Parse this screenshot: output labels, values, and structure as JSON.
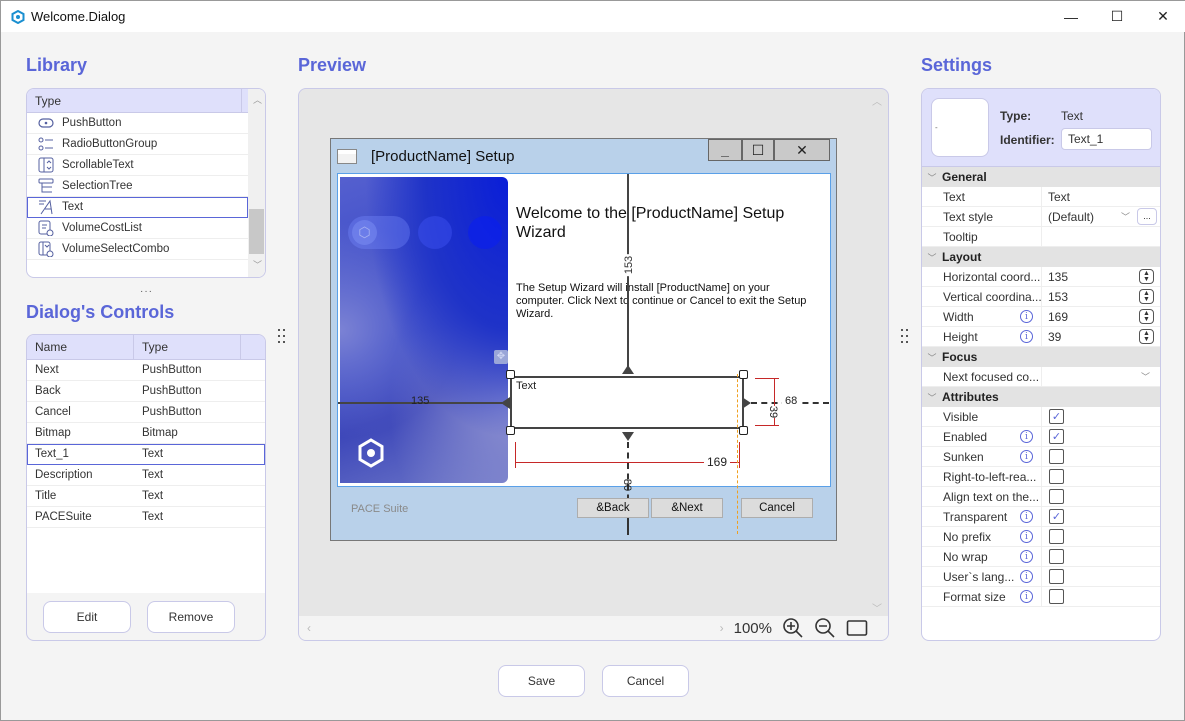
{
  "window": {
    "title": "Welcome.Dialog",
    "minimize_glyph": "—",
    "maximize_glyph": "☐",
    "close_glyph": "✕"
  },
  "library": {
    "title": "Library",
    "column": "Type",
    "items": [
      {
        "label": "PushButton",
        "icon": "push-button-icon"
      },
      {
        "label": "RadioButtonGroup",
        "icon": "radio-group-icon"
      },
      {
        "label": "ScrollableText",
        "icon": "scrollable-text-icon"
      },
      {
        "label": "SelectionTree",
        "icon": "selection-tree-icon"
      },
      {
        "label": "Text",
        "icon": "text-icon",
        "selected": true
      },
      {
        "label": "VolumeCostList",
        "icon": "volume-cost-list-icon"
      },
      {
        "label": "VolumeSelectCombo",
        "icon": "volume-select-combo-icon"
      }
    ]
  },
  "controls": {
    "title": "Dialog's Controls",
    "columns": [
      "Name",
      "Type"
    ],
    "rows": [
      [
        "Next",
        "PushButton"
      ],
      [
        "Back",
        "PushButton"
      ],
      [
        "Cancel",
        "PushButton"
      ],
      [
        "Bitmap",
        "Bitmap"
      ],
      [
        "Text_1",
        "Text"
      ],
      [
        "Description",
        "Text"
      ],
      [
        "Title",
        "Text"
      ],
      [
        "PACESuite",
        "Text"
      ]
    ],
    "selected_index": 4,
    "edit_label": "Edit",
    "remove_label": "Remove"
  },
  "preview": {
    "title": "Preview",
    "dialog_title": "[ProductName] Setup",
    "heading": "Welcome to the [ProductName] Setup Wizard",
    "description": "The Setup Wizard will install [ProductName] on your computer. Click Next to continue or Cancel to exit the Setup Wizard.",
    "selected_text": "Text",
    "footer_text": "PACE Suite",
    "back_label": "&Back",
    "next_label": "&Next",
    "cancel_label": "Cancel",
    "dimensions": {
      "left": "135",
      "top": "153",
      "width": "169",
      "height": "39",
      "right": "68",
      "bottom": "80"
    },
    "zoom": "100%"
  },
  "settings": {
    "title": "Settings",
    "type_label": "Type:",
    "type_value": "Text",
    "identifier_label": "Identifier:",
    "identifier_value": "Text_1",
    "groups": {
      "general": "General",
      "layout": "Layout",
      "focus": "Focus",
      "attributes": "Attributes"
    },
    "general": [
      {
        "name": "Text",
        "value": "Text"
      },
      {
        "name": "Text style",
        "value": "(Default)"
      },
      {
        "name": "Tooltip",
        "value": ""
      }
    ],
    "layout": [
      {
        "name": "Horizontal coord...",
        "value": "135"
      },
      {
        "name": "Vertical coordina...",
        "value": "153"
      },
      {
        "name": "Width",
        "value": "169"
      },
      {
        "name": "Height",
        "value": "39"
      }
    ],
    "focus": [
      {
        "name": "Next focused co...",
        "value": ""
      }
    ],
    "attributes": [
      {
        "name": "Visible",
        "checked": true,
        "info": false
      },
      {
        "name": "Enabled",
        "checked": true,
        "info": true
      },
      {
        "name": "Sunken",
        "checked": false,
        "info": true
      },
      {
        "name": "Right-to-left-rea...",
        "checked": false,
        "info": false
      },
      {
        "name": "Align text on the...",
        "checked": false,
        "info": false
      },
      {
        "name": "Transparent",
        "checked": true,
        "info": true
      },
      {
        "name": "No prefix",
        "checked": false,
        "info": true
      },
      {
        "name": "No wrap",
        "checked": false,
        "info": true
      },
      {
        "name": "User`s lang...",
        "checked": false,
        "info": true
      },
      {
        "name": "Format size",
        "checked": false,
        "info": true
      }
    ],
    "ellipsis_label": "..."
  },
  "footer": {
    "save_label": "Save",
    "cancel_label": "Cancel"
  }
}
